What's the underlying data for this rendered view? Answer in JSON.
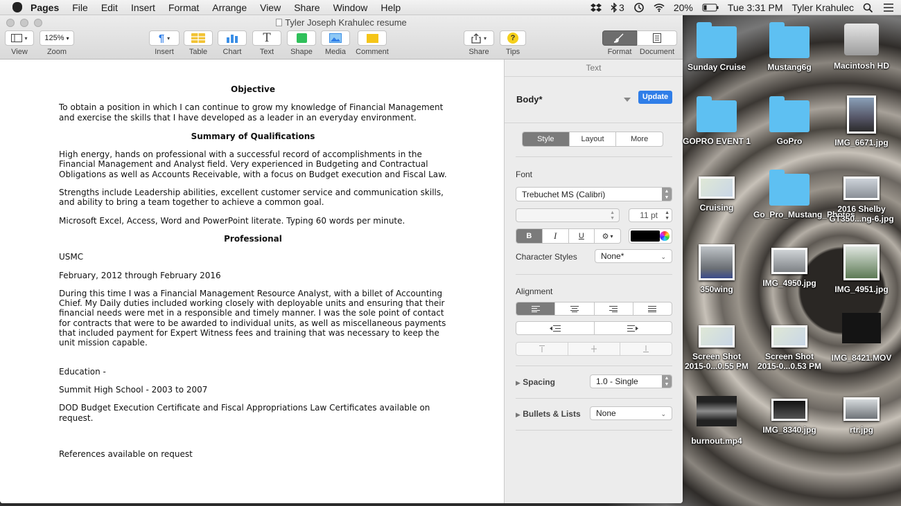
{
  "menubar": {
    "app": "Pages",
    "menus": [
      "File",
      "Edit",
      "Insert",
      "Format",
      "Arrange",
      "View",
      "Share",
      "Window",
      "Help"
    ],
    "wifi_count": "3",
    "battery": "20%",
    "clock": "Tue 3:31 PM",
    "user": "Tyler Krahulec"
  },
  "window": {
    "title": "Tyler Joseph Krahulec resume"
  },
  "toolbar": {
    "view": "View",
    "zoom_value": "125%",
    "zoom": "Zoom",
    "insert": "Insert",
    "table": "Table",
    "chart": "Chart",
    "text": "Text",
    "text_glyph": "T",
    "shape": "Shape",
    "media": "Media",
    "comment": "Comment",
    "share": "Share",
    "tips": "Tips",
    "tips_glyph": "?",
    "format": "Format",
    "document": "Document"
  },
  "doc": {
    "objective_h": "Objective",
    "objective": "To obtain a position in which I can continue to grow my knowledge of Financial Management and exercise the skills that I have developed as a leader in an everyday environment.",
    "summary_h": "Summary of Qualifications",
    "summary1": "High energy, hands on professional with a successful record of accomplishments in the Financial Management and Analyst field.  Very experienced in Budgeting and Contractual Obligations as well as Accounts Receivable, with a focus on Budget execution and Fiscal Law.",
    "summary2": "Strengths include Leadership abilities, excellent customer service and communication skills, and ability to bring a team together to achieve a common goal.",
    "summary3": "Microsoft Excel, Access, Word and PowerPoint literate. Typing 60 words per minute.",
    "professional_h": "Professional",
    "employer": "USMC",
    "dates": "February, 2012 through February 2016",
    "duties": "During this time I was a Financial Management Resource Analyst, with a billet of Accounting Chief. My Daily duties included working closely with deployable units and ensuring that their financial needs were met in a responsible and timely manner. I was the sole point of contact for contracts that were to be awarded to individual units, as well as miscellaneous payments that included payment for Expert Witness fees and training that was necessary to keep the unit mission capable.",
    "education": "Education -",
    "school": "Summit High School - 2003 to 2007",
    "certs": "DOD Budget Execution Certificate and Fiscal Appropriations Law Certificates available on request.",
    "references": "References available on request"
  },
  "inspector": {
    "title": "Text",
    "style_name": "Body*",
    "update": "Update",
    "tabs": [
      "Style",
      "Layout",
      "More"
    ],
    "font_label": "Font",
    "font_value": "Trebuchet MS (Calibri)",
    "font_size": "11 pt",
    "bold": "B",
    "italic": "I",
    "underline": "U",
    "gear": "⚙",
    "char_styles_label": "Character Styles",
    "char_styles_value": "None*",
    "alignment_label": "Alignment",
    "spacing_label": "Spacing",
    "spacing_value": "1.0 - Single",
    "bullets_label": "Bullets & Lists",
    "bullets_value": "None",
    "text_color": "#000000"
  },
  "desktop": [
    "Sunday Cruise",
    "Mustang6g",
    "Macintosh HD",
    "GOPRO EVENT 1",
    "GoPro",
    "IMG_6671.jpg",
    "Cruising",
    "Go_Pro_Mustang_Photos",
    "2016 Shelby GT350...ng-6.jpg",
    "350wing",
    "IMG_4950.jpg",
    "IMG_4951.jpg",
    "Screen Shot 2015-0...0.55 PM",
    "Screen Shot 2015-0...0.53 PM",
    "IMG_8421.MOV",
    "burnout.mp4",
    "IMG_8340.jpg",
    "rtr.jpg"
  ],
  "colors": {
    "accent": "#2f7ee8",
    "folder": "#5ec0f2",
    "table": "#f2c335",
    "chart": "#3a8ee6",
    "shape": "#2fc05a",
    "comment": "#f5c518",
    "tips": "#f5d01c"
  }
}
